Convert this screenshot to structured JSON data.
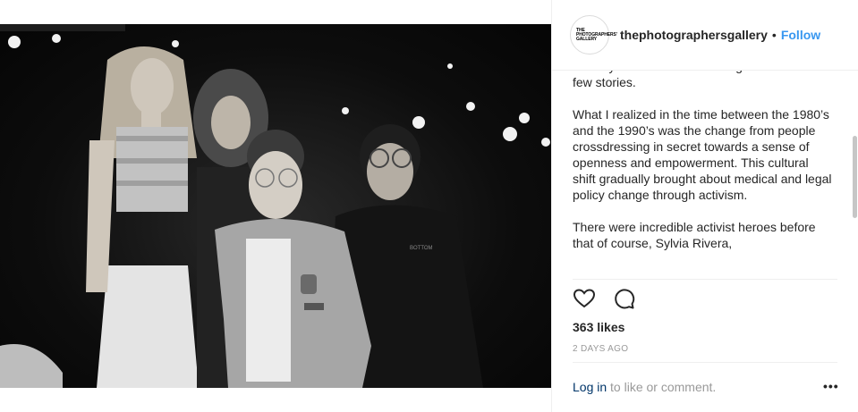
{
  "header": {
    "avatar_text": "THE PHOTOGRAPHERS' GALLERY",
    "username": "thephotographersgallery",
    "separator": "•",
    "follow_label": "Follow"
  },
  "caption": {
    "paragraphs": [
      "Sunday as I learn about Instagram and tell a few stories.",
      "What I realized in the time between the 1980’s and the 1990’s was the change from people crossdressing in secret towards a sense of openness and empowerment. This cultural shift gradually brought about medical and legal policy change through activism.",
      "There were incredible activist heroes before that of course, Sylvia Rivera,"
    ]
  },
  "photo": {
    "shirt_text": "BOTTOM"
  },
  "actions": {
    "like_icon": "heart-icon",
    "comment_icon": "comment-icon"
  },
  "likes": "363 likes",
  "date": "2 DAYS AGO",
  "footer": {
    "login_link": "Log in",
    "login_rest": " to like or comment.",
    "more": "•••"
  }
}
